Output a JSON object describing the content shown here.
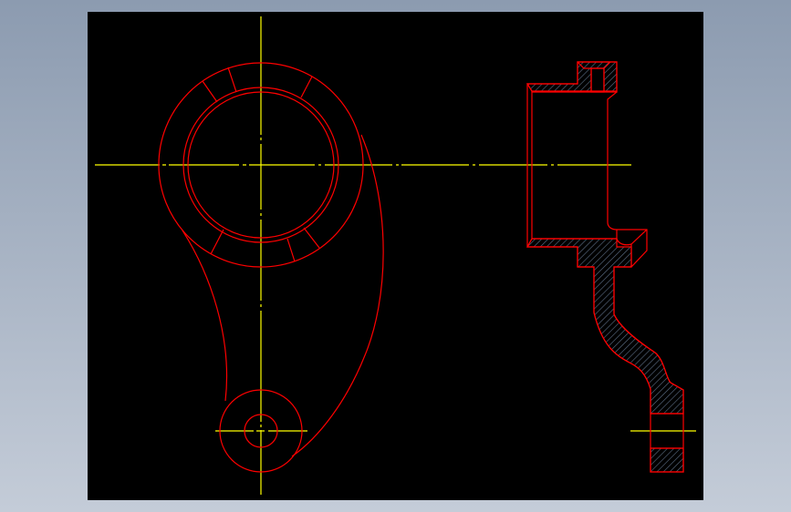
{
  "drawing": {
    "colors": {
      "background": "#000000",
      "outline": "#ff0000",
      "centerline": "#ffff00",
      "hatch": "#5f7088",
      "frame": "#9aa6b8"
    },
    "views": [
      "front-view",
      "section-view"
    ]
  }
}
